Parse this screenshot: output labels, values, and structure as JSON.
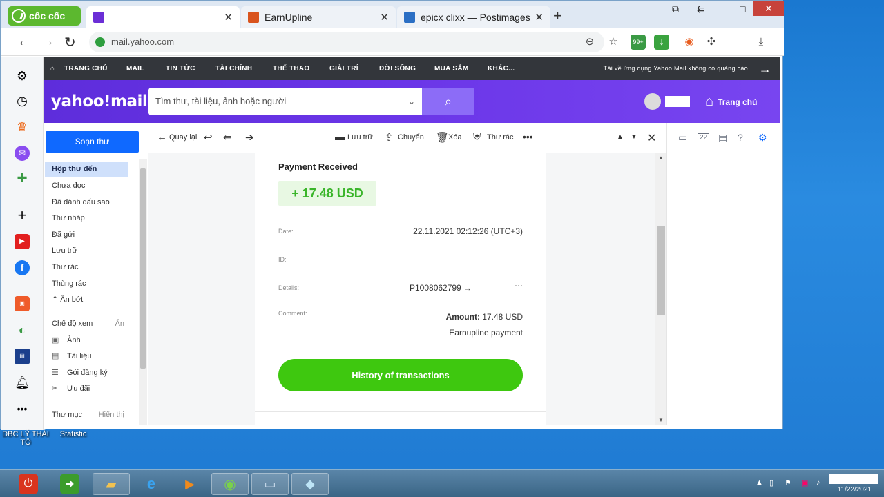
{
  "browser": {
    "brand": "cốc cốc",
    "tabs": [
      {
        "title": "",
        "active": true
      },
      {
        "title": "EarnUpline",
        "active": false
      },
      {
        "title": "epicx clixx — Postimages",
        "active": false
      }
    ],
    "url": "mail.yahoo.com",
    "extension_badge": "99+"
  },
  "yahoo_nav": {
    "items": [
      "TRANG CHỦ",
      "MAIL",
      "TIN TỨC",
      "TÀI CHÍNH",
      "THỂ THAO",
      "GIẢI TRÍ",
      "ĐỜI SỐNG",
      "MUA SẮM",
      "KHÁC..."
    ],
    "promo": "Tải về ứng dụng Yahoo Mail không có quảng cáo"
  },
  "header": {
    "logo": "yahoo!mail",
    "search_placeholder": "Tìm thư, tài liệu, ảnh hoặc người",
    "home_label": "Trang chủ"
  },
  "sidebar": {
    "compose_label": "Soạn thư",
    "folders": [
      "Hộp thư đến",
      "Chưa đọc",
      "Đã đánh dấu sao",
      "Thư nháp",
      "Đã gửi",
      "Lưu trữ",
      "Thư rác",
      "Thùng rác"
    ],
    "collapse_label": "Ẩn bớt",
    "views_title": "Chế độ xem",
    "views_hide": "Ẩn",
    "views": [
      "Ảnh",
      "Tài liệu",
      "Gói đăng ký",
      "Ưu đãi"
    ],
    "folders_title": "Thư mục",
    "folders_show": "Hiển thị"
  },
  "toolbar": {
    "back": "Quay lại",
    "archive": "Lưu trữ",
    "move": "Chuyển",
    "delete": "Xóa",
    "spam": "Thư rác",
    "more": "•••"
  },
  "email": {
    "title": "Payment Received",
    "amount_badge": "+ 17.48 USD",
    "date_label": "Date:",
    "date_value": "22.11.2021 02:12:26 (UTC+3)",
    "id_label": "ID:",
    "details_label": "Details:",
    "details_value": "P1008062799 →",
    "details_more": "···",
    "comment_label": "Comment:",
    "amount_label": "Amount:",
    "amount_value": "17.48 USD",
    "comment_value": "Earnupline payment",
    "history_button": "History of transactions"
  },
  "desktop": {
    "icons": [
      "DBC LÝ THÁI TỔ",
      "Statistic"
    ]
  },
  "taskbar": {
    "date": "11/22/2021"
  }
}
